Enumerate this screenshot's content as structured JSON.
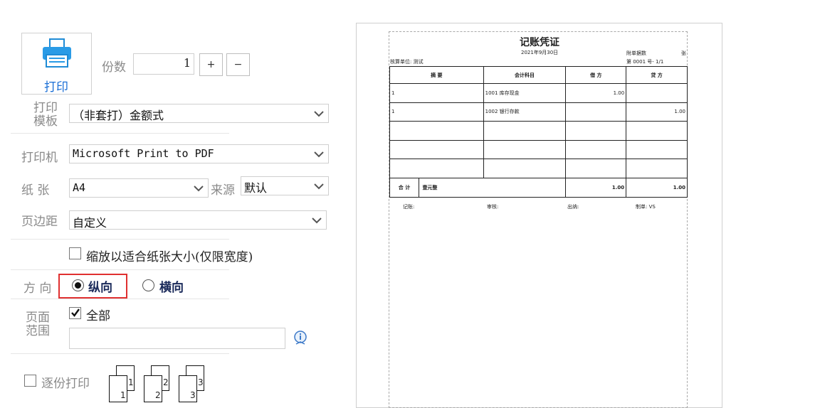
{
  "print_button": {
    "label": "打印"
  },
  "copies": {
    "label": "份数",
    "value": "1",
    "plus": "+",
    "minus": "−"
  },
  "template": {
    "label_line1": "打印",
    "label_line2": "模板",
    "value": "（非套打）金额式"
  },
  "printer": {
    "label": "打印机",
    "value": "Microsoft Print to PDF"
  },
  "paper": {
    "label": "纸 张",
    "value": "A4",
    "source_label": "来源",
    "source_value": "默认"
  },
  "margin": {
    "label": "页边距",
    "value": "自定义"
  },
  "fit": {
    "label": "缩放以适合纸张大小(仅限宽度)",
    "checked": false
  },
  "orientation": {
    "label": "方 向",
    "portrait": "纵向",
    "landscape": "横向",
    "selected": "portrait"
  },
  "range": {
    "label_line1": "页面",
    "label_line2": "范围",
    "all_label": "全部",
    "all_checked": true,
    "input_value": ""
  },
  "collate": {
    "label": "逐份打印",
    "checked": false,
    "pages": [
      "1",
      "2",
      "3"
    ]
  },
  "preview": {
    "title": "记账凭证",
    "date": "2021年9月30日",
    "attach_label": "附单据数",
    "attach_unit": "张",
    "unit_label": "核算单位: 测试",
    "number_label": "第  0001  号-  1/1",
    "headers": [
      "摘 要",
      "会计科目",
      "借 方",
      "贷 方"
    ],
    "rows": [
      {
        "summary": "1",
        "account": "1001 库存现金",
        "debit": "1.00",
        "credit": ""
      },
      {
        "summary": "1",
        "account": "1002 银行存款",
        "debit": "",
        "credit": "1.00"
      },
      {
        "summary": "",
        "account": "",
        "debit": "",
        "credit": ""
      },
      {
        "summary": "",
        "account": "",
        "debit": "",
        "credit": ""
      },
      {
        "summary": "",
        "account": "",
        "debit": "",
        "credit": ""
      }
    ],
    "total_label": "合 计",
    "total_words": "壹元整",
    "total_debit": "1.00",
    "total_credit": "1.00",
    "footer": [
      "记账:",
      "审核:",
      "出纳:",
      "制单: VS"
    ]
  }
}
